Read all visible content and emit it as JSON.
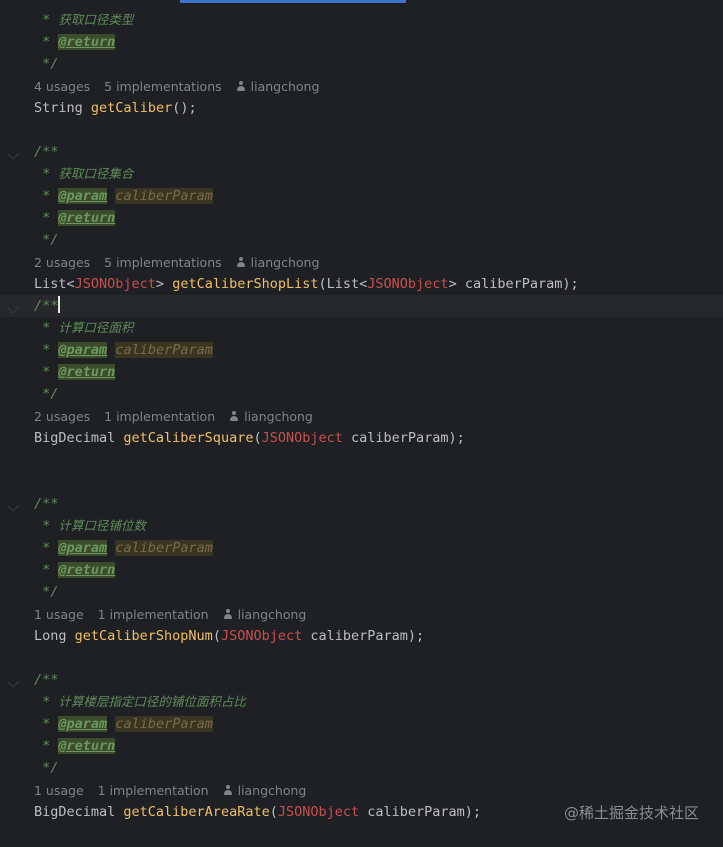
{
  "editor": {
    "methods": [
      {
        "doc_prefix_partial": true,
        "desc": "获取口径类型",
        "has_param": false,
        "usages": "4 usages",
        "implementations": "5 implementations",
        "author": "liangchong",
        "return_type": "String",
        "name": "getCaliber",
        "args": "()"
      },
      {
        "desc": "获取口径集合",
        "param_tag": "@param",
        "param_name": "caliberParam",
        "return_tag": "@return",
        "usages": "2 usages",
        "implementations": "5 implementations",
        "author": "liangchong",
        "sig_prefix": "List<",
        "sig_type": "JSONObject",
        "sig_mid": "> ",
        "name": "getCaliberShopList",
        "arg_open": "(List<",
        "arg_type": "JSONObject",
        "arg_close": "> caliberParam);"
      },
      {
        "desc": "计算口径面积",
        "param_tag": "@param",
        "param_name": "caliberParam",
        "return_tag": "@return",
        "usages": "2 usages",
        "implementations": "1 implementation",
        "author": "liangchong",
        "return_type": "BigDecimal ",
        "name": "getCaliberSquare",
        "arg_type": "JSONObject",
        "arg_rest": " caliberParam);"
      },
      {
        "desc": "计算口径铺位数",
        "param_tag": "@param",
        "param_name": "caliberParam",
        "return_tag": "@return",
        "usages": "1 usage",
        "implementations": "1 implementation",
        "author": "liangchong",
        "return_type": "Long ",
        "name": "getCaliberShopNum",
        "arg_type": "JSONObject",
        "arg_rest": " caliberParam);"
      },
      {
        "desc": "计算楼层指定口径的铺位面积占比",
        "param_tag": "@param",
        "param_name": "caliberParam",
        "return_tag": "@return",
        "usages": "1 usage",
        "implementations": "1 implementation",
        "author": "liangchong",
        "return_type": "BigDecimal ",
        "name": "getCaliberAreaRate",
        "arg_type": "JSONObject",
        "arg_rest": " caliberParam);"
      }
    ],
    "doc_open": "/**",
    "doc_star": " * ",
    "doc_close": " */",
    "return_tag": "@return"
  },
  "watermark": "@稀土掘金技术社区",
  "colors": {
    "background": "#1f2023",
    "comment": "#5f8c5a",
    "method": "#f0c060",
    "type_highlight": "#c94f4f",
    "meta": "#7f838a"
  }
}
